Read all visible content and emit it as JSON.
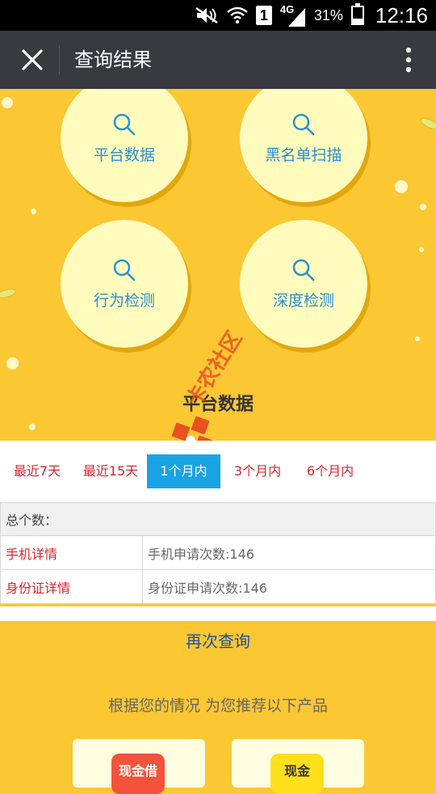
{
  "status_bar": {
    "sim_slot": "1",
    "network_type": "4G",
    "battery_percent": "31%",
    "battery_level": 0.31,
    "time": "12:16"
  },
  "app_bar": {
    "title": "查询结果"
  },
  "query_options": [
    {
      "label": "平台数据",
      "icon": "search-icon"
    },
    {
      "label": "黑名单扫描",
      "icon": "search-icon"
    },
    {
      "label": "行为检测",
      "icon": "search-icon"
    },
    {
      "label": "深度检测",
      "icon": "search-icon"
    }
  ],
  "section_title": "平台数据",
  "watermark_text": "卡农社区",
  "period_tabs": [
    {
      "label": "最近7天",
      "active": false
    },
    {
      "label": "最近15天",
      "active": false
    },
    {
      "label": "1个月内",
      "active": true
    },
    {
      "label": "3个月内",
      "active": false
    },
    {
      "label": "6个月内",
      "active": false
    }
  ],
  "summary_table": {
    "header": "总个数：",
    "rows": [
      {
        "key": "手机详情",
        "value": "手机申请次数:146"
      },
      {
        "key": "身份证详情",
        "value": "身份证申请次数:146"
      }
    ]
  },
  "requery_label": "再次查询",
  "recommend_text": "根据您的情况 为您推荐以下产品",
  "products": [
    {
      "logo_text": "现金借",
      "logo_color": "#f2533a",
      "logo_text_color": "#ffffff"
    },
    {
      "logo_text": "现金",
      "logo_color": "#ffe01a",
      "logo_text_color": "#333333"
    }
  ],
  "colors": {
    "background": "#fbc733",
    "circle_fill": "#fffbbd",
    "link_blue": "#2b8fd5",
    "tab_active": "#1aa3e4",
    "accent_red": "#e0242c",
    "app_bar": "#393a3f"
  }
}
